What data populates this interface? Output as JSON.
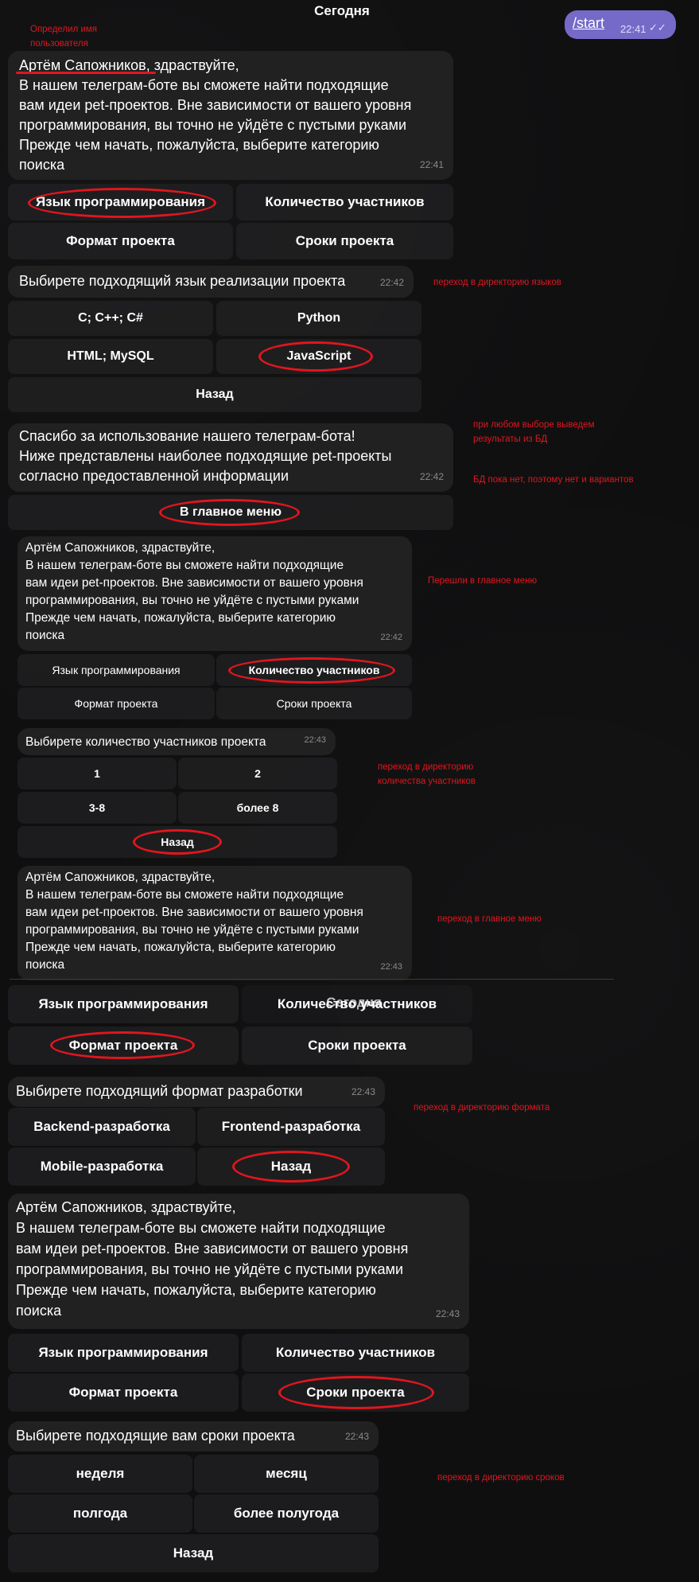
{
  "date_label": "Сегодня",
  "outgoing": {
    "command": "/start",
    "time": "22:41"
  },
  "colors": {
    "bubble": "#212121",
    "outgoing": "#766ac8",
    "annotation": "#e0161e",
    "background": "#0f0f10"
  },
  "greeting": {
    "name": "Артём Сапожников",
    "rest": ", здраствуйте,",
    "body": "В нашем телеграм-боте вы сможете найти подходящие\nвам идеи pet-проектов. Вне зависимости от вашего уровня\nпрограммирования, вы точно не уйдёте с пустыми руками\nПрежде чем начать, пожалуйста, выберите категорию\nпоиска",
    "full": "Артём Сапожников, здраствуйте,\nВ нашем телеграм-боте вы сможете найти подходящие\nвам идеи pet-проектов. Вне зависимости от вашего уровня\nпрограммирования, вы точно не уйдёте с пустыми руками\nПрежде чем начать, пожалуйста, выберите категорию\nпоиска"
  },
  "menu_buttons": {
    "language": "Язык программирования",
    "participants": "Количество участников",
    "format": "Формат проекта",
    "deadlines": "Сроки проекта"
  },
  "times": {
    "t1": "22:41",
    "t2": "22:42",
    "t3": "22:42",
    "t4": "22:42",
    "t5": "22:43",
    "t6": "22:43",
    "t7": "22:43",
    "t8": "22:43",
    "t9": "22:43"
  },
  "lang_prompt": "Выбирете подходящий язык реализации проекта",
  "lang_options": {
    "c": "C; C++; C#",
    "python": "Python",
    "html": "HTML; MySQL",
    "js": "JavaScript",
    "back": "Назад"
  },
  "thanks": {
    "text": "Спасибо за использование нашего телеграм-бота!\nНиже представлены наиболее подходящие pet-проекты\nсогласно предоставленной информации",
    "main_menu_button": "В главное меню"
  },
  "participants_prompt": "Выбирете количество участников проекта",
  "participants_options": {
    "one": "1",
    "two": "2",
    "three_eight": "3-8",
    "more8": "более 8",
    "back": "Назад"
  },
  "format_prompt": "Выбирете подходящий формат разработки",
  "format_options": {
    "backend": "Backend-разработка",
    "frontend": "Frontend-разработка",
    "mobile": "Mobile-разработка",
    "back": "Назад"
  },
  "deadline_prompt": "Выбирете подходящие вам сроки проекта",
  "deadline_options": {
    "week": "неделя",
    "month": "месяц",
    "half": "полгода",
    "more_half": "более полугода",
    "back": "Назад"
  },
  "annotations": {
    "username": "Определил имя\nпользователя",
    "lang_dir": "переход в директорию языков",
    "results": "при любом выборе выведем\nрезультаты из БД",
    "no_db": "БД пока нет, поэтому нет и вариантов",
    "main_menu": "Перешли в главное меню",
    "participants_dir": "переход в директорию\nколичества участников",
    "main_menu2": "переход в главное меню",
    "format_dir": "переход в директорию формата",
    "deadline_dir": "переход в директорию сроков"
  }
}
